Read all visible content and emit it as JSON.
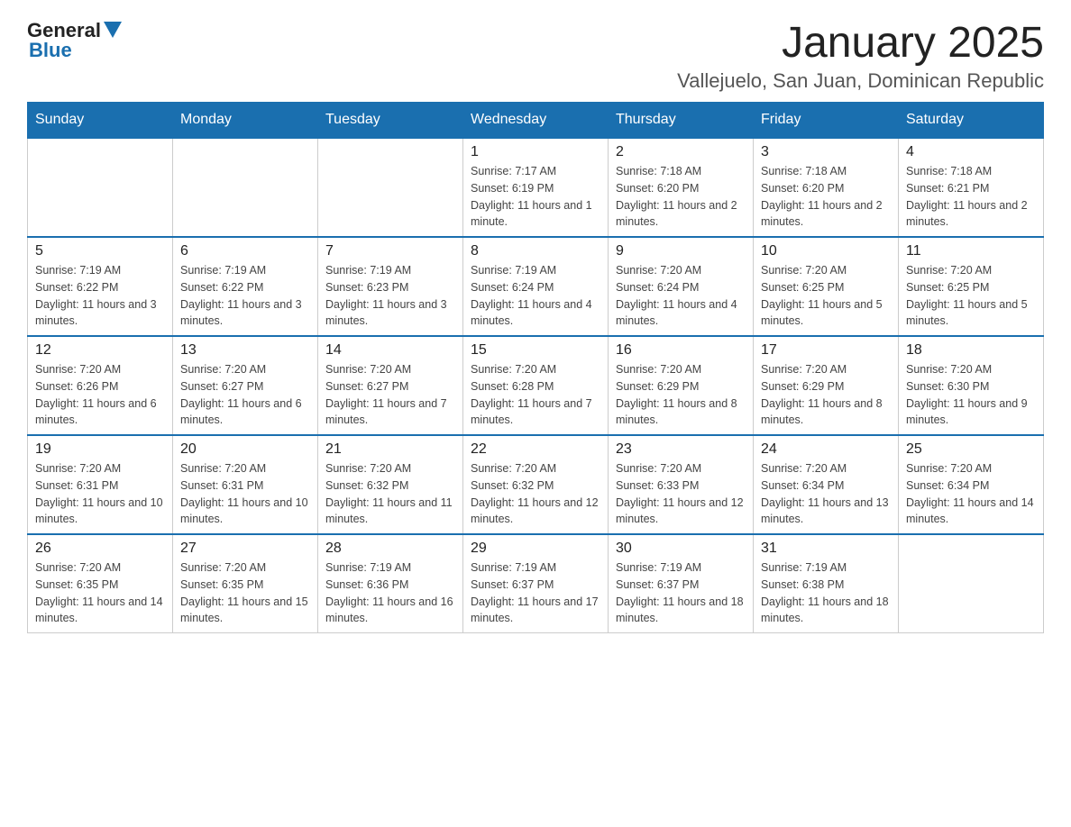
{
  "logo": {
    "general": "General",
    "blue": "Blue"
  },
  "title": "January 2025",
  "subtitle": "Vallejuelo, San Juan, Dominican Republic",
  "days_header": [
    "Sunday",
    "Monday",
    "Tuesday",
    "Wednesday",
    "Thursday",
    "Friday",
    "Saturday"
  ],
  "weeks": [
    [
      {
        "day": "",
        "info": ""
      },
      {
        "day": "",
        "info": ""
      },
      {
        "day": "",
        "info": ""
      },
      {
        "day": "1",
        "info": "Sunrise: 7:17 AM\nSunset: 6:19 PM\nDaylight: 11 hours and 1 minute."
      },
      {
        "day": "2",
        "info": "Sunrise: 7:18 AM\nSunset: 6:20 PM\nDaylight: 11 hours and 2 minutes."
      },
      {
        "day": "3",
        "info": "Sunrise: 7:18 AM\nSunset: 6:20 PM\nDaylight: 11 hours and 2 minutes."
      },
      {
        "day": "4",
        "info": "Sunrise: 7:18 AM\nSunset: 6:21 PM\nDaylight: 11 hours and 2 minutes."
      }
    ],
    [
      {
        "day": "5",
        "info": "Sunrise: 7:19 AM\nSunset: 6:22 PM\nDaylight: 11 hours and 3 minutes."
      },
      {
        "day": "6",
        "info": "Sunrise: 7:19 AM\nSunset: 6:22 PM\nDaylight: 11 hours and 3 minutes."
      },
      {
        "day": "7",
        "info": "Sunrise: 7:19 AM\nSunset: 6:23 PM\nDaylight: 11 hours and 3 minutes."
      },
      {
        "day": "8",
        "info": "Sunrise: 7:19 AM\nSunset: 6:24 PM\nDaylight: 11 hours and 4 minutes."
      },
      {
        "day": "9",
        "info": "Sunrise: 7:20 AM\nSunset: 6:24 PM\nDaylight: 11 hours and 4 minutes."
      },
      {
        "day": "10",
        "info": "Sunrise: 7:20 AM\nSunset: 6:25 PM\nDaylight: 11 hours and 5 minutes."
      },
      {
        "day": "11",
        "info": "Sunrise: 7:20 AM\nSunset: 6:25 PM\nDaylight: 11 hours and 5 minutes."
      }
    ],
    [
      {
        "day": "12",
        "info": "Sunrise: 7:20 AM\nSunset: 6:26 PM\nDaylight: 11 hours and 6 minutes."
      },
      {
        "day": "13",
        "info": "Sunrise: 7:20 AM\nSunset: 6:27 PM\nDaylight: 11 hours and 6 minutes."
      },
      {
        "day": "14",
        "info": "Sunrise: 7:20 AM\nSunset: 6:27 PM\nDaylight: 11 hours and 7 minutes."
      },
      {
        "day": "15",
        "info": "Sunrise: 7:20 AM\nSunset: 6:28 PM\nDaylight: 11 hours and 7 minutes."
      },
      {
        "day": "16",
        "info": "Sunrise: 7:20 AM\nSunset: 6:29 PM\nDaylight: 11 hours and 8 minutes."
      },
      {
        "day": "17",
        "info": "Sunrise: 7:20 AM\nSunset: 6:29 PM\nDaylight: 11 hours and 8 minutes."
      },
      {
        "day": "18",
        "info": "Sunrise: 7:20 AM\nSunset: 6:30 PM\nDaylight: 11 hours and 9 minutes."
      }
    ],
    [
      {
        "day": "19",
        "info": "Sunrise: 7:20 AM\nSunset: 6:31 PM\nDaylight: 11 hours and 10 minutes."
      },
      {
        "day": "20",
        "info": "Sunrise: 7:20 AM\nSunset: 6:31 PM\nDaylight: 11 hours and 10 minutes."
      },
      {
        "day": "21",
        "info": "Sunrise: 7:20 AM\nSunset: 6:32 PM\nDaylight: 11 hours and 11 minutes."
      },
      {
        "day": "22",
        "info": "Sunrise: 7:20 AM\nSunset: 6:32 PM\nDaylight: 11 hours and 12 minutes."
      },
      {
        "day": "23",
        "info": "Sunrise: 7:20 AM\nSunset: 6:33 PM\nDaylight: 11 hours and 12 minutes."
      },
      {
        "day": "24",
        "info": "Sunrise: 7:20 AM\nSunset: 6:34 PM\nDaylight: 11 hours and 13 minutes."
      },
      {
        "day": "25",
        "info": "Sunrise: 7:20 AM\nSunset: 6:34 PM\nDaylight: 11 hours and 14 minutes."
      }
    ],
    [
      {
        "day": "26",
        "info": "Sunrise: 7:20 AM\nSunset: 6:35 PM\nDaylight: 11 hours and 14 minutes."
      },
      {
        "day": "27",
        "info": "Sunrise: 7:20 AM\nSunset: 6:35 PM\nDaylight: 11 hours and 15 minutes."
      },
      {
        "day": "28",
        "info": "Sunrise: 7:19 AM\nSunset: 6:36 PM\nDaylight: 11 hours and 16 minutes."
      },
      {
        "day": "29",
        "info": "Sunrise: 7:19 AM\nSunset: 6:37 PM\nDaylight: 11 hours and 17 minutes."
      },
      {
        "day": "30",
        "info": "Sunrise: 7:19 AM\nSunset: 6:37 PM\nDaylight: 11 hours and 18 minutes."
      },
      {
        "day": "31",
        "info": "Sunrise: 7:19 AM\nSunset: 6:38 PM\nDaylight: 11 hours and 18 minutes."
      },
      {
        "day": "",
        "info": ""
      }
    ]
  ]
}
